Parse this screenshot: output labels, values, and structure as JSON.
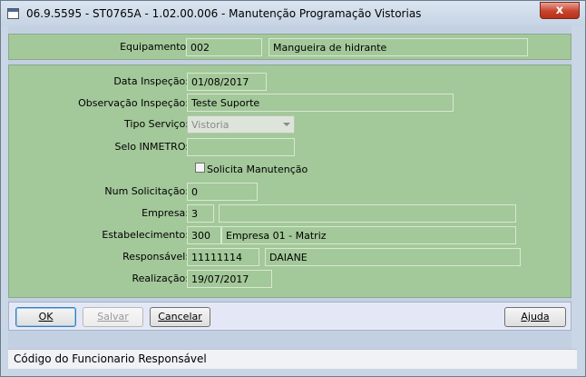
{
  "window": {
    "title": "06.9.5595 - ST0765A - 1.02.00.006 - Manutenção Programação Vistorias",
    "close_glyph": "x"
  },
  "equipment": {
    "label": "Equipamento:",
    "code": "002",
    "description": "Mangueira de hidrante"
  },
  "form": {
    "data_inspecao": {
      "label": "Data Inspeção:",
      "value": "01/08/2017"
    },
    "observacao": {
      "label": "Observação Inspeção:",
      "value": "Teste Suporte"
    },
    "tipo_servico": {
      "label": "Tipo Serviço:",
      "value": "Vistoria"
    },
    "selo": {
      "label": "Selo INMETRO:",
      "value": ""
    },
    "solicita": {
      "label": "Solicita Manutenção",
      "checked": false
    },
    "num_solicitacao": {
      "label": "Num Solicitação:",
      "value": "0"
    },
    "empresa": {
      "label": "Empresa:",
      "code": "3",
      "name": ""
    },
    "estabelecimento": {
      "label": "Estabelecimento:",
      "code": "300",
      "name": "Empresa 01 - Matriz"
    },
    "responsavel": {
      "label": "Responsável:",
      "code": "11111114",
      "name": "DAIANE"
    },
    "realizacao": {
      "label": "Realização:",
      "value": "19/07/2017"
    }
  },
  "buttons": {
    "ok": "OK",
    "salvar": "Salvar",
    "cancelar": "Cancelar",
    "ajuda": "Ajuda"
  },
  "status_bar": {
    "text": "Código do Funcionario Responsável"
  },
  "colors": {
    "panel_green": "#a3c89a",
    "window_blue": "#c3d0e2",
    "close_red": "#c7442d"
  }
}
